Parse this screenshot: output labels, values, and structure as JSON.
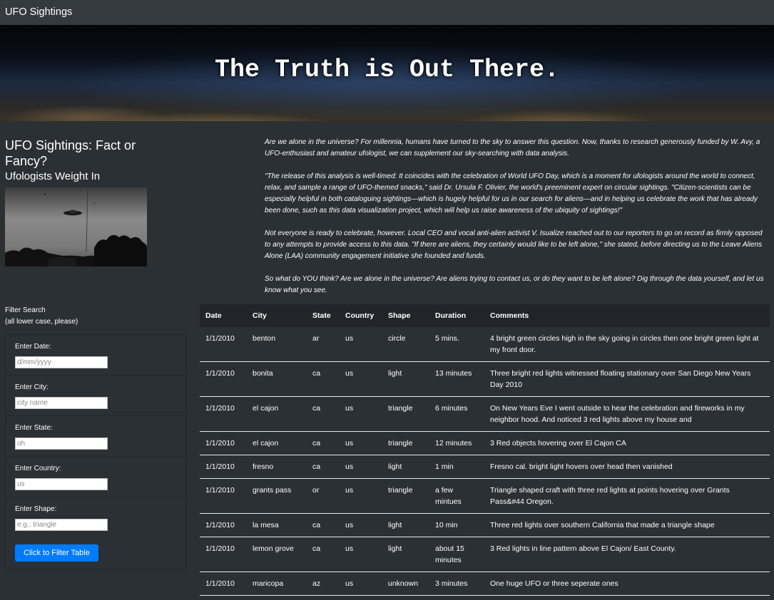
{
  "navbar": {
    "brand": "UFO Sightings"
  },
  "hero": {
    "title": "The Truth is Out There."
  },
  "sidebar": {
    "heading": "UFO Sightings: Fact or Fancy?",
    "subheading": "Ufologists Weight In",
    "filter_title": "Filter Search",
    "filter_note": "(all lower case, please)",
    "filters": [
      {
        "label": "Enter Date:",
        "placeholder": "d/mm/yyyy"
      },
      {
        "label": "Enter City:",
        "placeholder": "city name"
      },
      {
        "label": "Enter State:",
        "placeholder": "oh"
      },
      {
        "label": "Enter Country:",
        "placeholder": "us"
      },
      {
        "label": "Enter Shape:",
        "placeholder": "e.g.: triangle"
      }
    ],
    "button_label": "Click to Filter Table"
  },
  "article": {
    "paragraphs": [
      "Are we alone in the universe? For millennia, humans have turned to the sky to answer this question. Now, thanks to research generously funded by W. Avy, a UFO-enthusiast and amateur ufologist, we can supplement our sky-searching with data analysis.",
      "\"The release of this analysis is well-timed: It coincides with the celebration of World UFO Day, which is a moment for ufologists around the world to connect, relax, and sample a range of UFO-themed snacks,\" said Dr. Ursula F. Olivier, the world's preeminent expert on circular sightings. \"Citizen-scientists can be especially helpful in both cataloguing sightings—which is hugely helpful for us in our search for aliens—and in helping us celebrate the work that has already been done, such as this data visualization project, which will help us raise awareness of the ubiquity of sightings!\"",
      "Not everyone is ready to celebrate, however. Local CEO and vocal anti-alien activist V. Isualize reached out to our reporters to go on record as firmly opposed to any attempts to provide access to this data. \"If there are aliens, they certainly would like to be left alone,\" she stated, before directing us to the Leave Aliens Alone (LAA) community engagement initiative she founded and funds.",
      "So what do YOU think? Are we alone in the universe? Are aliens trying to contact us, or do they want to be left alone? Dig through the data yourself, and let us know what you see."
    ]
  },
  "table": {
    "headers": [
      "Date",
      "City",
      "State",
      "Country",
      "Shape",
      "Duration",
      "Comments"
    ],
    "rows": [
      [
        "1/1/2010",
        "benton",
        "ar",
        "us",
        "circle",
        "5 mins.",
        "4 bright green circles high in the sky going in circles then one bright green light at my front door."
      ],
      [
        "1/1/2010",
        "bonita",
        "ca",
        "us",
        "light",
        "13 minutes",
        "Three bright red lights witnessed floating stationary over San Diego New Years Day 2010"
      ],
      [
        "1/1/2010",
        "el cajon",
        "ca",
        "us",
        "triangle",
        "6 minutes",
        "On New Years Eve I went outside to hear the celebration and fireworks in my neighbor hood. And noticed 3 red lights above my house and"
      ],
      [
        "1/1/2010",
        "el cajon",
        "ca",
        "us",
        "triangle",
        "12 minutes",
        "3 Red objects hovering over El Cajon CA"
      ],
      [
        "1/1/2010",
        "fresno",
        "ca",
        "us",
        "light",
        "1 min",
        "Fresno cal. bright light hovers over head then vanished"
      ],
      [
        "1/1/2010",
        "grants pass",
        "or",
        "us",
        "triangle",
        "a few mintues",
        "Triangle shaped craft with three red lights at points hovering over Grants Pass&#44 Oregon."
      ],
      [
        "1/1/2010",
        "la mesa",
        "ca",
        "us",
        "light",
        "10 min",
        "Three red lights over southern California that made a triangle shape"
      ],
      [
        "1/1/2010",
        "lemon grove",
        "ca",
        "us",
        "light",
        "about 15 minutes",
        "3 Red lights in line pattern above El Cajon/ East County."
      ],
      [
        "1/1/2010",
        "maricopa",
        "az",
        "us",
        "unknown",
        "3 minutes",
        "One huge UFO or three seperate ones"
      ]
    ]
  }
}
